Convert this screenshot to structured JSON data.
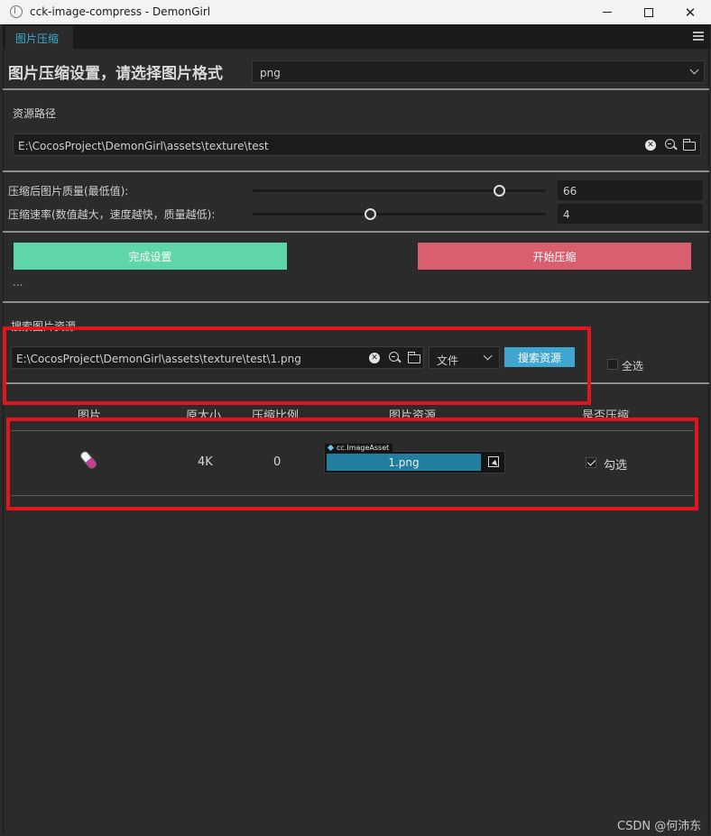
{
  "window": {
    "title": "cck-image-compress - DemonGirl"
  },
  "tab": {
    "label": "图片压缩"
  },
  "settings": {
    "heading": "图片压缩设置，请选择图片格式",
    "format_selected": "png"
  },
  "resource_path": {
    "label": "资源路径",
    "value": "E:\\CocosProject\\DemonGirl\\assets\\texture\\test"
  },
  "quality": {
    "label": "压缩后图片质量(最低值):",
    "value": "66",
    "slider_fraction": 0.84
  },
  "speed": {
    "label": "压缩速率(数值越大，速度越快，质量越低):",
    "value": "4",
    "slider_fraction": 0.4
  },
  "actions": {
    "done_label": "完成设置",
    "start_label": "开始压缩",
    "status": "..."
  },
  "search": {
    "label": "搜索图片资源",
    "path_value": "E:\\CocosProject\\DemonGirl\\assets\\texture\\test\\1.png",
    "type_selected": "文件",
    "search_label": "搜索资源",
    "select_all_label": "全选"
  },
  "table": {
    "headers": [
      "图片",
      "原大小",
      "压缩比例",
      "图片资源",
      "是否压缩"
    ],
    "rows": [
      {
        "size": "4K",
        "ratio": "0",
        "asset_type": "cc.ImageAsset",
        "asset_name": "1.png",
        "compress_label": "勾选",
        "compress_checked": true
      }
    ]
  },
  "watermark": "CSDN @何沛东",
  "colors": {
    "accent_tab": "#3aa9d4",
    "done_button": "#5fd6a9",
    "start_button": "#d95f6f",
    "search_button": "#3ea6d0",
    "asset_value": "#217e9f",
    "highlight_red": "#e0161f"
  }
}
